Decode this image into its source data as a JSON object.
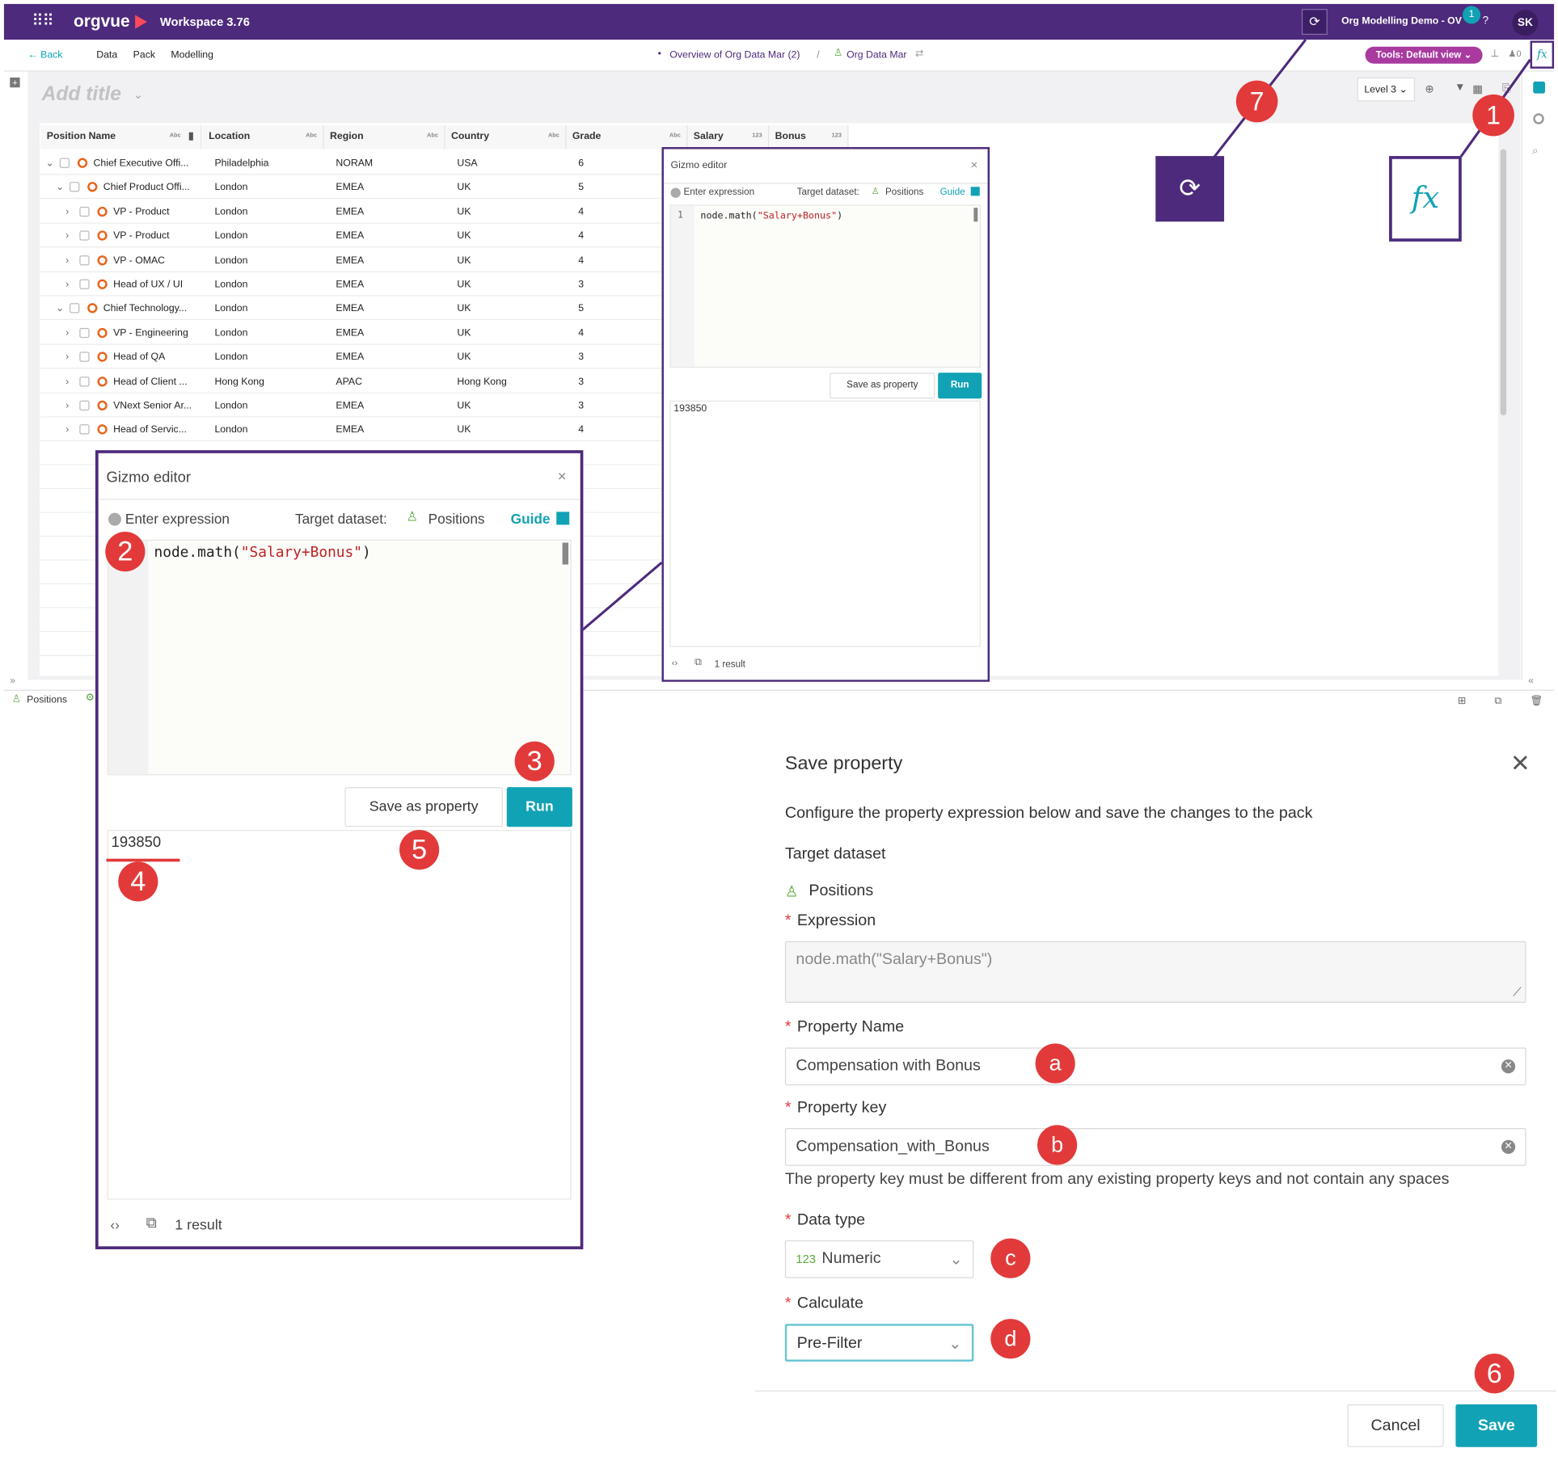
{
  "topbar": {
    "app_name": "orgvue",
    "workspace": "Workspace",
    "version": "3.76",
    "dataset_name": "Org Modelling Demo - OV",
    "notification_count": "1",
    "help": "?",
    "user_initials": "SK"
  },
  "nav": {
    "back": "Back",
    "menu": [
      "Data",
      "Pack",
      "Modelling"
    ],
    "breadcrumb_1": "Overview of Org Data Mar (2)",
    "breadcrumb_sep": "/",
    "breadcrumb_2": "Org Data Mar",
    "tools_view": "Tools: Default view",
    "count": "0"
  },
  "canvas": {
    "title_placeholder": "Add title",
    "level": "Level 3"
  },
  "grid": {
    "columns": [
      {
        "label": "Position Name",
        "type": "Abc"
      },
      {
        "label": "Location",
        "type": "Abc"
      },
      {
        "label": "Region",
        "type": "Abc"
      },
      {
        "label": "Country",
        "type": "Abc"
      },
      {
        "label": "Grade",
        "type": "Abc"
      },
      {
        "label": "Salary",
        "type": "123"
      },
      {
        "label": "Bonus",
        "type": "123"
      }
    ],
    "rows": [
      {
        "name": "Chief Executive Offi...",
        "location": "Philadelphia",
        "region": "NORAM",
        "country": "USA",
        "grade": "6"
      },
      {
        "name": "Chief Product Offi...",
        "location": "London",
        "region": "EMEA",
        "country": "UK",
        "grade": "5"
      },
      {
        "name": "VP - Product",
        "location": "London",
        "region": "EMEA",
        "country": "UK",
        "grade": "4"
      },
      {
        "name": "VP - Product",
        "location": "London",
        "region": "EMEA",
        "country": "UK",
        "grade": "4"
      },
      {
        "name": "VP - OMAC",
        "location": "London",
        "region": "EMEA",
        "country": "UK",
        "grade": "4"
      },
      {
        "name": "Head of UX / UI",
        "location": "London",
        "region": "EMEA",
        "country": "UK",
        "grade": "3"
      },
      {
        "name": "Chief Technology...",
        "location": "London",
        "region": "EMEA",
        "country": "UK",
        "grade": "5"
      },
      {
        "name": "VP - Engineering",
        "location": "London",
        "region": "EMEA",
        "country": "UK",
        "grade": "4"
      },
      {
        "name": "Head of QA",
        "location": "London",
        "region": "EMEA",
        "country": "UK",
        "grade": "3"
      },
      {
        "name": "Head of Client ...",
        "location": "Hong Kong",
        "region": "APAC",
        "country": "Hong Kong",
        "grade": "3"
      },
      {
        "name": "VNext Senior Ar...",
        "location": "London",
        "region": "EMEA",
        "country": "UK",
        "grade": "3"
      },
      {
        "name": "Head of Servic...",
        "location": "London",
        "region": "EMEA",
        "country": "UK",
        "grade": "4"
      }
    ]
  },
  "bottom_tab": {
    "label": "Positions"
  },
  "gizmo": {
    "title": "Gizmo editor",
    "close": "×",
    "enter_expression": "Enter expression",
    "target_label": "Target dataset:",
    "target_value": "Positions",
    "guide": "Guide",
    "line_number": "1",
    "code_fn": "node.math(",
    "code_str": "\"Salary+Bonus\"",
    "code_close": ")",
    "save_as_property": "Save as property",
    "run": "Run",
    "result_value": "193850",
    "result_count": "1 result"
  },
  "save_property": {
    "title": "Save property",
    "description": "Configure the property expression below and save the changes to the pack",
    "target_dataset_label": "Target dataset",
    "target_dataset_value": "Positions",
    "expression_label": "Expression",
    "expression_value": "node.math(\"Salary+Bonus\")",
    "property_name_label": "Property Name",
    "property_name_value": "Compensation with Bonus",
    "property_key_label": "Property key",
    "property_key_value": "Compensation_with_Bonus",
    "property_key_hint": "The property key must be different from any existing property keys and not contain any spaces",
    "data_type_label": "Data type",
    "data_type_prefix": "123",
    "data_type_value": "Numeric",
    "calculate_label": "Calculate",
    "calculate_value": "Pre-Filter",
    "cancel": "Cancel",
    "save": "Save",
    "required_mark": "*"
  },
  "callouts": {
    "n1": "1",
    "n2": "2",
    "n3": "3",
    "n4": "4",
    "n5": "5",
    "n6": "6",
    "n7": "7",
    "a": "a",
    "b": "b",
    "c": "c",
    "d": "d",
    "fx_icon": "fx"
  },
  "colors": {
    "topbar": "#4d2a7c",
    "accent": "#11a2b5",
    "callout": "#e23a3a",
    "row_icon": "#e8641a",
    "tools_badge": "#a83aa0"
  }
}
